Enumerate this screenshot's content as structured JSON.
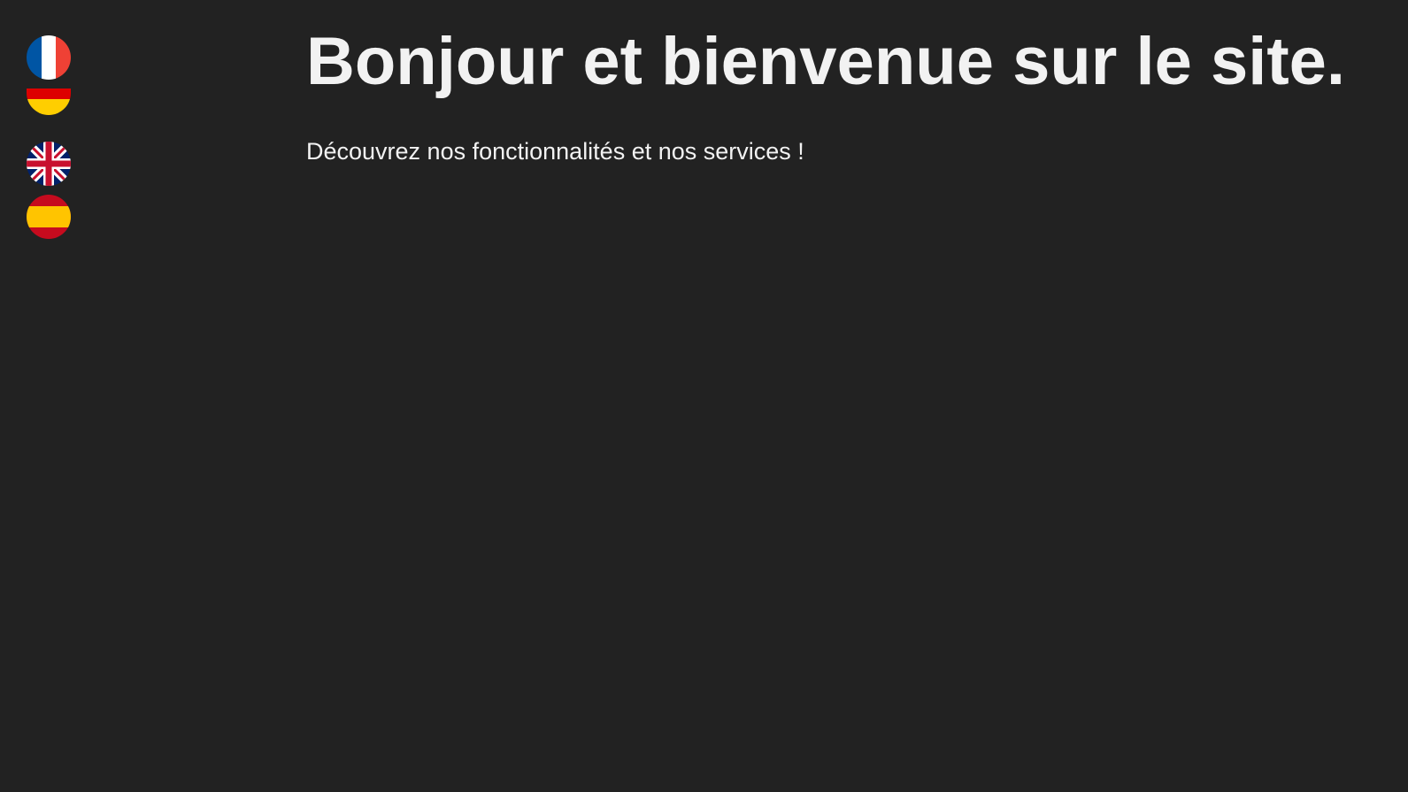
{
  "languages": [
    {
      "code": "fr",
      "icon": "france-flag-icon",
      "colors": [
        "#0055a4",
        "#ffffff",
        "#ef4135"
      ]
    },
    {
      "code": "de",
      "icon": "germany-flag-icon",
      "colors": [
        "#000000",
        "#dd0000",
        "#ffce00"
      ]
    },
    {
      "code": "en",
      "icon": "united-kingdom-flag-icon",
      "colors": [
        "#012169",
        "#ffffff",
        "#c8102e"
      ]
    },
    {
      "code": "es",
      "icon": "spain-flag-icon",
      "colors": [
        "#c60b1e",
        "#ffc400"
      ]
    }
  ],
  "hero": {
    "title": "Bonjour et bienvenue sur le site.",
    "subtitle": "Découvrez nos fonctionnalités et nos services !"
  },
  "theme": {
    "background": "#222222",
    "text": "#f2f2f2"
  }
}
